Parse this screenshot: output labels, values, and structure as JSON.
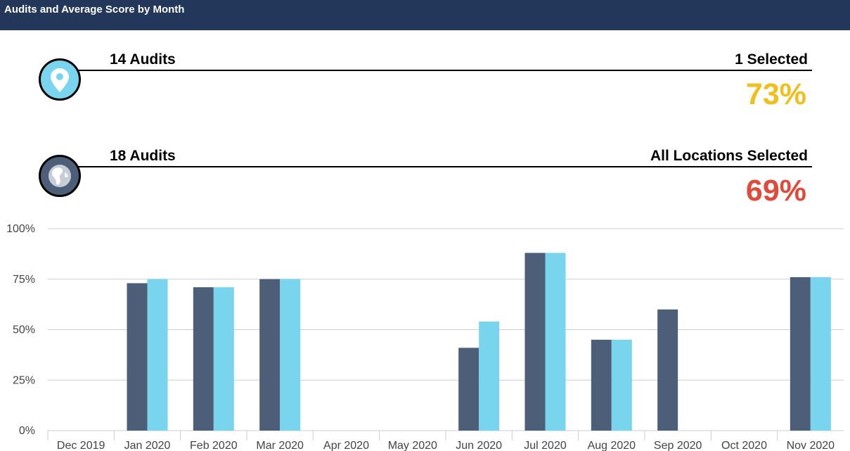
{
  "header": {
    "title": "Audits and Average Score by Month"
  },
  "summary": {
    "selected": {
      "icon": "location-pin-icon",
      "audits_label": "14 Audits",
      "selection_label": "1 Selected",
      "score": "73%",
      "score_color": "#f0bf1b",
      "icon_bg": "#79d4ed"
    },
    "all": {
      "icon": "globe-icon",
      "audits_label": "18 Audits",
      "selection_label": "All Locations Selected",
      "score": "69%",
      "score_color": "#e04a3a",
      "icon_bg": "#4d5e78"
    }
  },
  "chart_data": {
    "type": "bar",
    "categories": [
      "Dec 2019",
      "Jan 2020",
      "Feb 2020",
      "Mar 2020",
      "Apr 2020",
      "May 2020",
      "Jun 2020",
      "Jul 2020",
      "Aug 2020",
      "Sep 2020",
      "Oct 2020",
      "Nov 2020"
    ],
    "series": [
      {
        "values": [
          null,
          73,
          71,
          75,
          null,
          null,
          41,
          88,
          45,
          60,
          null,
          76
        ],
        "color": "#4d5e78"
      },
      {
        "values": [
          null,
          75,
          71,
          75,
          null,
          null,
          54,
          88,
          45,
          null,
          null,
          76
        ],
        "color": "#79d4ed"
      }
    ],
    "yticks": [
      "0%",
      "25%",
      "50%",
      "75%",
      "100%"
    ],
    "ylim": [
      0,
      100
    ],
    "grid": true,
    "legend": false
  }
}
